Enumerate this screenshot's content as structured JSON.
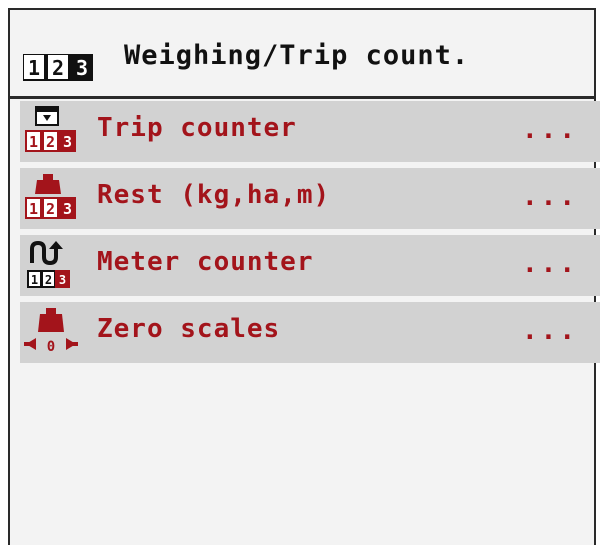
{
  "header": {
    "title": "Weighing/Trip count.",
    "icon": "counter-icon"
  },
  "menu": {
    "items": [
      {
        "label": "Trip counter",
        "more": "...",
        "icon": "trip-counter-icon"
      },
      {
        "label": "Rest (kg,ha,m)",
        "more": "...",
        "icon": "rest-weight-icon"
      },
      {
        "label": "Meter counter",
        "more": "...",
        "icon": "meter-counter-icon"
      },
      {
        "label": "Zero scales",
        "more": "...",
        "icon": "zero-scales-icon"
      }
    ]
  },
  "colors": {
    "label": "#a3141b",
    "item_bg": "#d2d2d2",
    "screen_bg": "#f3f3f3"
  }
}
